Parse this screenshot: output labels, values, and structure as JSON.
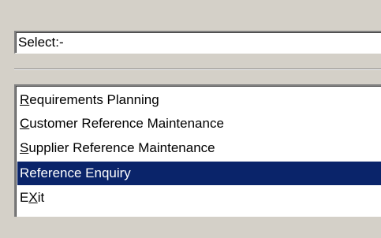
{
  "select_field": {
    "value": "Select:-"
  },
  "menu": {
    "items": [
      {
        "mnemonic": "R",
        "rest": "equirements Planning",
        "pre": "",
        "selected": false
      },
      {
        "mnemonic": "C",
        "rest": "ustomer Reference Maintenance",
        "pre": "",
        "selected": false
      },
      {
        "mnemonic": "S",
        "rest": "upplier Reference Maintenance",
        "pre": "",
        "selected": false
      },
      {
        "mnemonic": "",
        "rest": "Reference Enquiry",
        "pre": "",
        "selected": true
      },
      {
        "mnemonic": "X",
        "rest": "it",
        "pre": "E",
        "selected": false
      }
    ]
  },
  "colors": {
    "window_bg": "#d4d0c8",
    "selection_bg": "#0a246a",
    "selection_fg": "#ffffff"
  }
}
